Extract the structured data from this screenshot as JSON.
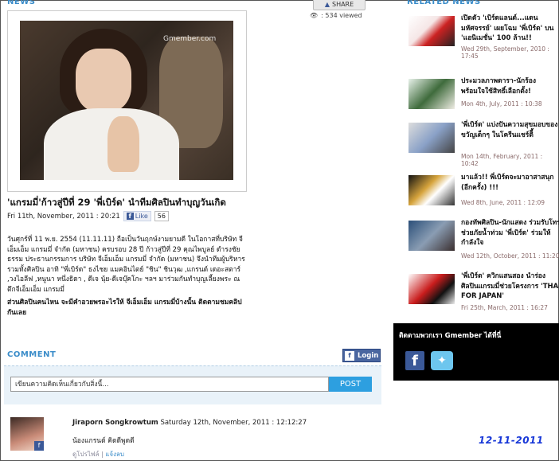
{
  "header": {
    "news_label": "NEWS",
    "share_label": "SHARE",
    "views_text": ": 534 viewed",
    "related_label": "RELATED NEWS"
  },
  "article": {
    "photo_watermark": "Gmember.com",
    "headline": "'แกรมมี่'ก้าวสู่ปีที่ 29 'พี่เบิร์ด' นำทีมศิลปินทำบุญวันเกิด",
    "date": "Fri 11th, November, 2011 : 20:21",
    "like_label": "Like",
    "like_count": "56",
    "body": "วันศุกร์ที่ 11 พ.ย. 2554 (11.11.11) ถือเป็นวันฤกษ์งามยามดี ในโอกาสที่บริษัท จีเอ็มเอ็ม แกรมมี่ จำกัด (มหาชน) ครบรอบ 28 ปี ก้าวสู่ปีที่ 29 คุณไพบูลย์ ดำรงชัยธรรม ประธานกรรมการ บริษัท จีเอ็มเอ็ม แกรมมี่ จำกัด (มหาชน) จึงนำทีมผู้บริหารรวมทั้งศิลปิน อาทิ \"พี่เบิร์ด\" ธงไชย แมคอินไตย์ \"ชิน\" ชินวุฒ ,แกรนด์ เดอะสตาร์ ,วงไอลีฟ ,หนูนา หนึ่งธิดา , ดีเจ นุ้ย-ดีเจบุ๊คโกะ ฯลฯ มาร่วมกันทำบุญเลี้ยงพระ ณ ตึกจีเอ็มเอ็ม แกรมมี่",
    "body_bold": "ส่วนศิลปินคนไหน จะมีคำอวยพรอะไรให้ จีเอ็มเอ็ม แกรมมี่บ้างนั้น ติดตามชมคลิปกันเลย"
  },
  "comments": {
    "title": "COMMENT",
    "login_label": "Login",
    "input_placeholder": "เขียนความคิดเห็นเกี่ยวกับสิ่งนี้...",
    "post_label": "POST",
    "items": [
      {
        "author": "Jiraporn Songkrowtum",
        "time": "Saturday 12th, November, 2011 : 12:12:27",
        "text": "น้องแกรนด์ คิดดีพูดดี",
        "profile_link": "ดูโปรไฟล์",
        "separator": "|",
        "delete_link": "แจ้งลบ"
      }
    ]
  },
  "date_stamp": "12-11-2011",
  "related": [
    {
      "title": "เปิดตัว 'เบิร์ดแลนด์...แดนมหัศจรรย์' เผยโฉม 'พี่เบิร์ด' บน 'แอนิเมชั่น' 100 ล้าน!!",
      "date": "Wed 29th, September, 2010 : 17:45"
    },
    {
      "title": "ประมวลภาพดารา-นักร้อง พร้อมใจใช้สิทธิ์เลือกตั้ง!",
      "date": "Mon 4th, July, 2011 : 10:38"
    },
    {
      "title": "'พี่เบิร์ด' แบ่งปันความสุขมอบของขวัญเด็กๆ ในโครีนแชร์ติี้",
      "date": "Mon 14th, February, 2011 : 10:42"
    },
    {
      "title": "มาแล้ว!! พี่เบิร์ดจะมาอาสาสนุก (อีกครั้ง) !!!",
      "date": "Wed 8th, June, 2011 : 12:09"
    },
    {
      "title": "กองทัพศิลปิน-นักแสดง ร่วมรับโทรช่วยภัยน้ำท่วม 'พี่เบิร์ด' ร่วมให้กำลังใจ",
      "date": "Wed 12th, October, 2011 : 11:20"
    },
    {
      "title": "'พี่เบิร์ด' ควิกแสนสอง นำร่องศิลปินแกรมมี่ช่วยโครงการ 'THAI FOR JAPAN'",
      "date": "Fri 25th, March, 2011 : 16:27"
    }
  ],
  "follow": {
    "title": "ติดตามพวกเรา Gmember ได้ที่นี่"
  },
  "colors": {
    "accent": "#3a8cc9",
    "facebook": "#3b5998",
    "post_button": "#2d9fe0",
    "date_stamp": "#1838d8"
  }
}
